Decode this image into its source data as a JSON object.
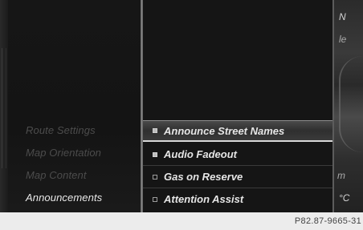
{
  "menu": {
    "items": [
      {
        "label": "Route Settings",
        "active": false
      },
      {
        "label": "Map Orientation",
        "active": false
      },
      {
        "label": "Map Content",
        "active": false
      },
      {
        "label": "Announcements",
        "active": true
      }
    ]
  },
  "options": [
    {
      "label": "Announce Street Names",
      "checked": true,
      "selected": true
    },
    {
      "label": "Audio Fadeout",
      "checked": true,
      "selected": false
    },
    {
      "label": "Gas on Reserve",
      "checked": false,
      "selected": false
    },
    {
      "label": "Attention Assist",
      "checked": false,
      "selected": false
    }
  ],
  "side_strip": {
    "top_char": "N",
    "top_char2": "le",
    "mid_char": "m",
    "temp_unit": "°C"
  },
  "footer": {
    "reference": "P82.87-9665-31"
  }
}
